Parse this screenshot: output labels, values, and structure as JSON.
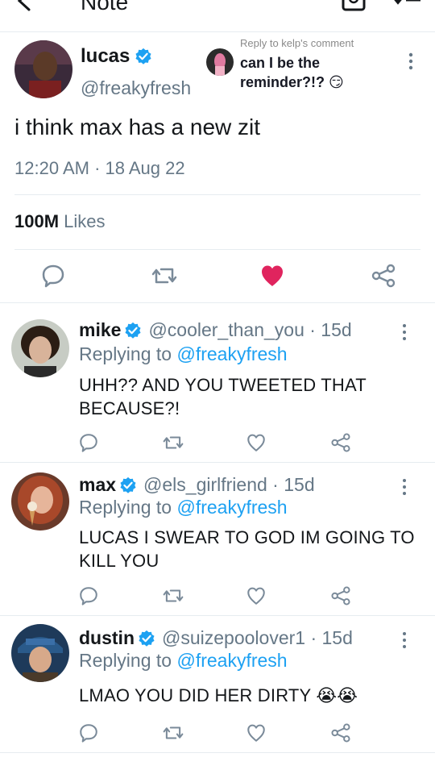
{
  "header": {
    "title": "Note",
    "back_icon": "chevron-left-icon",
    "icon1": "camera-frame-icon",
    "icon2": "sort-list-icon"
  },
  "popup": {
    "label": "Reply to kelp's comment",
    "text": "can I be the reminder?!? 😏"
  },
  "main_tweet": {
    "name": "lucas",
    "handle": "@freakyfresh",
    "text": "i think max has a new zit",
    "timestamp": "12:20 AM · 18 Aug 22",
    "likes_count": "100M",
    "likes_label": "Likes",
    "liked": true,
    "heart_color": "#e0245e"
  },
  "replies": [
    {
      "name": "mike",
      "handle": "@cooler_than_you · 15d",
      "replying_prefix": "Replying to",
      "replying_to": "@freakyfresh",
      "text": "UHH?? AND YOU TWEETED THAT BECAUSE?!"
    },
    {
      "name": "max",
      "handle": "@els_girlfriend · 15d",
      "replying_prefix": "Replying to",
      "replying_to": "@freakyfresh",
      "text": "LUCAS I SWEAR TO GOD IM GOING TO KILL YOU"
    },
    {
      "name": "dustin",
      "handle": "@suizepoolover1 · 15d",
      "replying_prefix": "Replying to",
      "replying_to": "@freakyfresh",
      "text": "LMAO YOU DID HER DIRTY 😭😭"
    }
  ],
  "colors": {
    "accent": "#1da1f2",
    "muted": "#657786",
    "divider": "#e6ecf0",
    "action_icon": "#7a8a99"
  }
}
